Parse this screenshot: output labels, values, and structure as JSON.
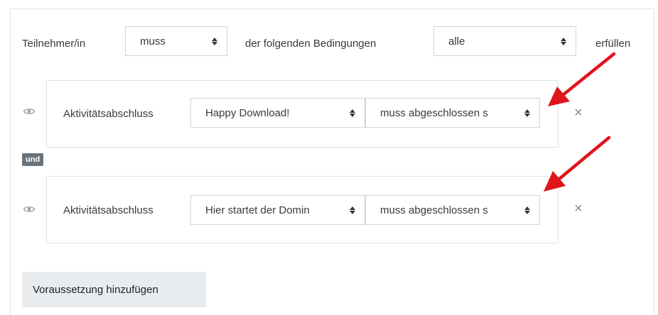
{
  "header": {
    "participant_label": "Teilnehmer/in",
    "must_select": "muss",
    "conditions_label": "der folgenden Bedingungen",
    "all_select": "alle",
    "fulfill_label": "erfüllen"
  },
  "conditions": [
    {
      "type_label": "Aktivitätsabschluss",
      "activity_select": "Happy Download!",
      "status_select": "muss abgeschlossen s",
      "delete_icon": "×"
    },
    {
      "type_label": "Aktivitätsabschluss",
      "activity_select": "Hier startet der Domin",
      "status_select": "muss abgeschlossen s",
      "delete_icon": "×"
    }
  ],
  "connector_label": "und",
  "add_button_label": "Voraussetzung hinzufügen",
  "colors": {
    "arrow": "#e0141b",
    "badge": "#6a737b",
    "button_bg": "#e9ecef"
  },
  "icons": {
    "eye": "eye-icon",
    "delete": "close-icon",
    "caret": "sort-caret-icon",
    "annotation": "red-arrow-icon"
  }
}
